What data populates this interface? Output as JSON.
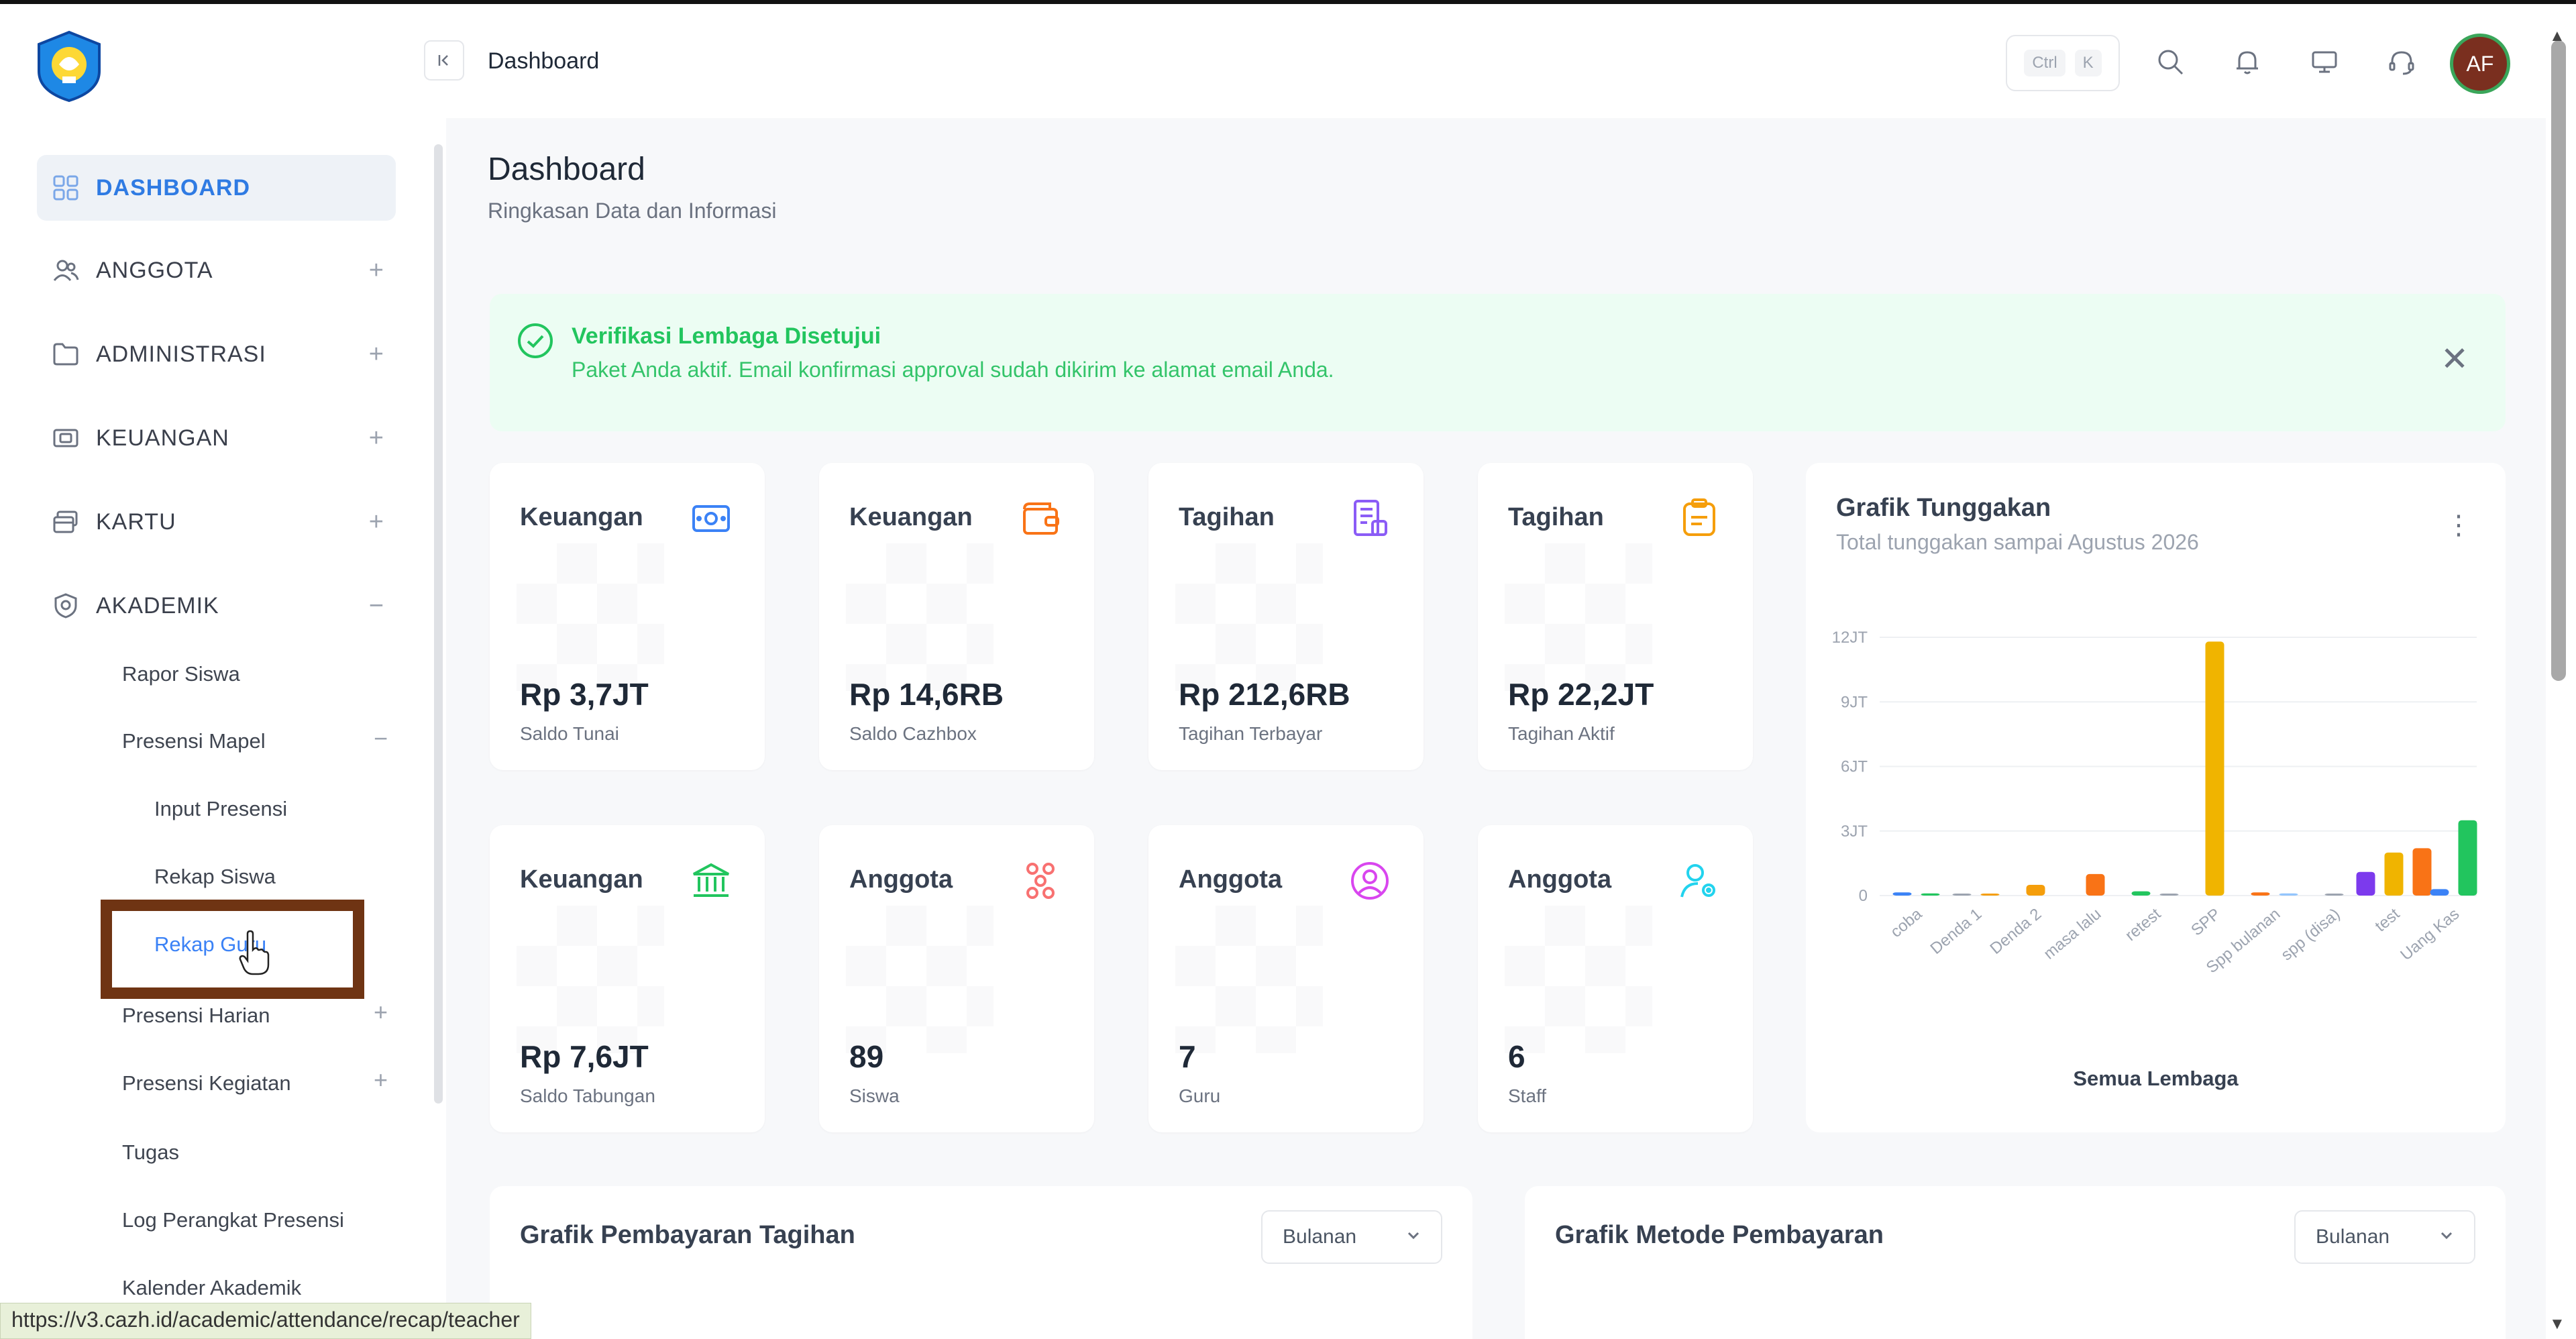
{
  "browser": {
    "status_url": "https://v3.cazh.id/academic/attendance/recap/teacher"
  },
  "sidebar": {
    "items": [
      {
        "label": "DASHBOARD",
        "icon": "grid-icon"
      },
      {
        "label": "ANGGOTA",
        "icon": "users-icon"
      },
      {
        "label": "ADMINISTRASI",
        "icon": "folder-icon"
      },
      {
        "label": "KEUANGAN",
        "icon": "money-icon"
      },
      {
        "label": "KARTU",
        "icon": "card-icon"
      },
      {
        "label": "AKADEMIK",
        "icon": "shield-icon"
      }
    ],
    "academic": {
      "rapor_siswa": "Rapor Siswa",
      "presensi_mapel": "Presensi Mapel",
      "input_presensi": "Input Presensi",
      "rekap_siswa": "Rekap Siswa",
      "rekap_guru": "Rekap Guru",
      "presensi_harian": "Presensi Harian",
      "presensi_kegiatan": "Presensi Kegiatan",
      "tugas": "Tugas",
      "log_perangkat": "Log Perangkat Presensi",
      "kalender": "Kalender Akademik"
    }
  },
  "header": {
    "breadcrumb": "Dashboard",
    "shortcut_ctrl": "Ctrl",
    "shortcut_k": "K",
    "avatar_initials": "AF"
  },
  "page": {
    "title": "Dashboard",
    "subtitle": "Ringkasan Data dan Informasi"
  },
  "alert": {
    "title": "Verifikasi Lembaga Disetujui",
    "text": "Paket Anda aktif. Email konfirmasi approval sudah dikirim ke alamat email Anda."
  },
  "cards": [
    {
      "title": "Keuangan",
      "value": "Rp 3,7JT",
      "label": "Saldo Tunai",
      "icon": "cash-icon",
      "color": "#3b82f6"
    },
    {
      "title": "Keuangan",
      "value": "Rp 14,6RB",
      "label": "Saldo Cazhbox",
      "icon": "wallet-icon",
      "color": "#f97316"
    },
    {
      "title": "Tagihan",
      "value": "Rp 212,6RB",
      "label": "Tagihan Terbayar",
      "icon": "invoice-icon",
      "color": "#8b5cf6"
    },
    {
      "title": "Tagihan",
      "value": "Rp 22,2JT",
      "label": "Tagihan Aktif",
      "icon": "clipboard-icon",
      "color": "#f59e0b"
    },
    {
      "title": "Keuangan",
      "value": "Rp 7,6JT",
      "label": "Saldo Tabungan",
      "icon": "bank-icon",
      "color": "#22c55e"
    },
    {
      "title": "Anggota",
      "value": "89",
      "label": "Siswa",
      "icon": "students-icon",
      "color": "#f87171"
    },
    {
      "title": "Anggota",
      "value": "7",
      "label": "Guru",
      "icon": "user-circle-icon",
      "color": "#d946ef"
    },
    {
      "title": "Anggota",
      "value": "6",
      "label": "Staff",
      "icon": "user-settings-icon",
      "color": "#22d3ee"
    }
  ],
  "arrears_chart": {
    "title": "Grafik Tunggakan",
    "subtitle": "Total tunggakan sampai Agustus 2026",
    "footer": "Semua Lembaga"
  },
  "chart_data": {
    "type": "bar",
    "title": "Grafik Tunggakan",
    "subtitle": "Total tunggakan sampai Agustus 2026",
    "xlabel": "Semua Lembaga",
    "ylabel": "",
    "yticks": [
      "0",
      "3JT",
      "6JT",
      "9JT",
      "12JT"
    ],
    "ylim": [
      0,
      12000000
    ],
    "categories": [
      "coba",
      "Denda 1",
      "Denda 2",
      "masa lalu",
      "retest",
      "SPP",
      "Spp bulanan",
      "spp (disa)",
      "test",
      "Uang Kas"
    ],
    "series": [
      {
        "values": [
          150000,
          100000,
          500000,
          200000,
          11800000,
          150000,
          1100000,
          2200000,
          3500000
        ]
      },
      {
        "values": [
          100000,
          50000,
          1000000,
          100000,
          100000,
          2000000
        ]
      },
      {
        "values": []
      }
    ],
    "bars": [
      {
        "category": "coba",
        "value": 150000,
        "color": "#3b82f6"
      },
      {
        "category": "coba",
        "value": 100000,
        "color": "#22c55e"
      },
      {
        "category": "Denda 1",
        "value": 60000,
        "color": "#9ca3af"
      },
      {
        "category": "Denda 1",
        "value": 50000,
        "color": "#f59e0b"
      },
      {
        "category": "Denda 2",
        "value": 500000,
        "color": "#f59e0b"
      },
      {
        "category": "masa lalu",
        "value": 1000000,
        "color": "#f97316"
      },
      {
        "category": "retest",
        "value": 200000,
        "color": "#22c55e"
      },
      {
        "category": "retest",
        "value": 50000,
        "color": "#9ca3af"
      },
      {
        "category": "SPP",
        "value": 11800000,
        "color": "#f0b400"
      },
      {
        "category": "Spp bulanan",
        "value": 150000,
        "color": "#f97316"
      },
      {
        "category": "Spp bulanan",
        "value": 100000,
        "color": "#93c5fd"
      },
      {
        "category": "spp (disa)",
        "value": 50000,
        "color": "#9ca3af"
      },
      {
        "category": "test",
        "value": 1100000,
        "color": "#7c3aed"
      },
      {
        "category": "test",
        "value": 2000000,
        "color": "#f0b400"
      },
      {
        "category": "test",
        "value": 2200000,
        "color": "#f97316"
      },
      {
        "category": "Uang Kas",
        "value": 300000,
        "color": "#3b82f6"
      },
      {
        "category": "Uang Kas",
        "value": 3500000,
        "color": "#22c55e"
      }
    ],
    "grid": true,
    "legend": "none"
  },
  "panels": {
    "payment_chart": {
      "title": "Grafik Pembayaran Tagihan",
      "select": "Bulanan"
    },
    "method_chart": {
      "title": "Grafik Metode Pembayaran",
      "select": "Bulanan"
    }
  }
}
